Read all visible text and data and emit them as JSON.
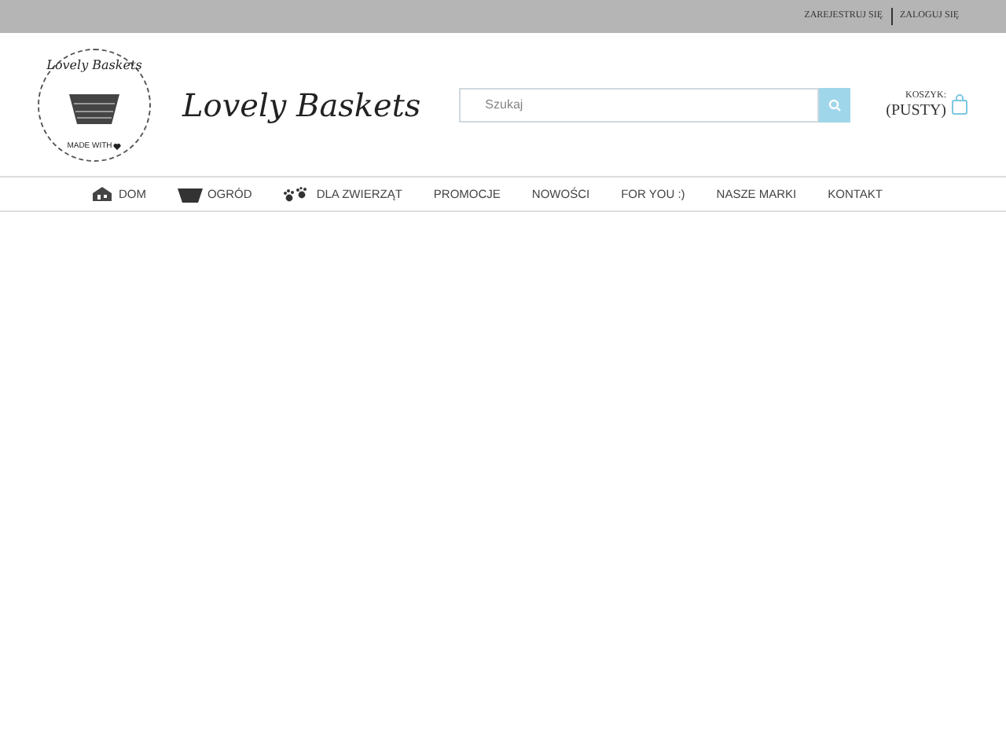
{
  "top_bar": {
    "links": [
      "ZAREJESTRUJ SIĘ",
      "ZALOGUJ SIĘ"
    ]
  },
  "logo": {
    "arc_text": "Lovely Baskets",
    "bottom_text": "MADE WITH"
  },
  "brand": "Lovely Baskets",
  "search": {
    "placeholder": "Szukaj"
  },
  "cart": {
    "label": "KOSZYK:",
    "status": "(PUSTY)"
  },
  "nav": [
    {
      "label": "DOM",
      "kind": "house"
    },
    {
      "label": "OGRÓD",
      "kind": "basket"
    },
    {
      "label": "DLA ZWIERZĄT",
      "kind": "paws"
    },
    {
      "label": "PROMOCJE",
      "kind": "plain"
    },
    {
      "label": "NOWOŚCI",
      "kind": "plain"
    },
    {
      "label": "FOR YOU :)",
      "kind": "plain"
    },
    {
      "label": "NASZE MARKI",
      "kind": "plain"
    },
    {
      "label": "KONTAKT",
      "kind": "plain"
    }
  ]
}
